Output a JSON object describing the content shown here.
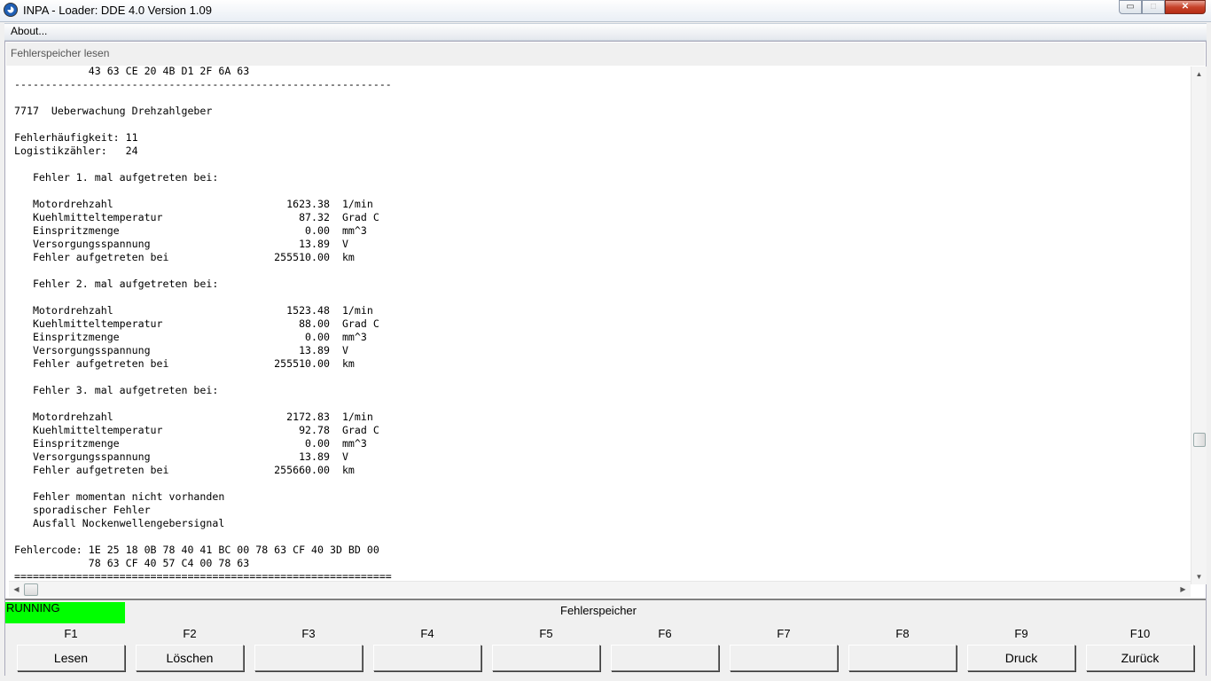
{
  "window": {
    "title": "INPA - Loader:  DDE 4.0 Version 1.09",
    "min_glyph": "▭",
    "max_glyph": "□",
    "close_glyph": "✕",
    "icon": "bmw-logo-icon"
  },
  "menu": {
    "about": "About..."
  },
  "section": {
    "title": "Fehlerspeicher lesen"
  },
  "report_lines": [
    "            43 63 CE 20 4B D1 2F 6A 63",
    "-------------------------------------------------------------",
    "",
    "7717  Ueberwachung Drehzahlgeber",
    "",
    "Fehlerhäufigkeit: 11",
    "Logistikzähler:   24",
    "",
    "   Fehler 1. mal aufgetreten bei:",
    "",
    "   Motordrehzahl                            1623.38  1/min",
    "   Kuehlmitteltemperatur                      87.32  Grad C",
    "   Einspritzmenge                              0.00  mm^3",
    "   Versorgungsspannung                        13.89  V",
    "   Fehler aufgetreten bei                 255510.00  km",
    "",
    "   Fehler 2. mal aufgetreten bei:",
    "",
    "   Motordrehzahl                            1523.48  1/min",
    "   Kuehlmitteltemperatur                      88.00  Grad C",
    "   Einspritzmenge                              0.00  mm^3",
    "   Versorgungsspannung                        13.89  V",
    "   Fehler aufgetreten bei                 255510.00  km",
    "",
    "   Fehler 3. mal aufgetreten bei:",
    "",
    "   Motordrehzahl                            2172.83  1/min",
    "   Kuehlmitteltemperatur                      92.78  Grad C",
    "   Einspritzmenge                              0.00  mm^3",
    "   Versorgungsspannung                        13.89  V",
    "   Fehler aufgetreten bei                 255660.00  km",
    "",
    "   Fehler momentan nicht vorhanden",
    "   sporadischer Fehler",
    "   Ausfall Nockenwellengebersignal",
    "",
    "Fehlercode: 1E 25 18 0B 78 40 41 BC 00 78 63 CF 40 3D BD 00",
    "            78 63 CF 40 57 C4 00 78 63",
    "============================================================="
  ],
  "scroll": {
    "up": "▲",
    "down": "▼",
    "left": "◀",
    "right": "▶"
  },
  "status": {
    "state": "RUNNING",
    "title": "Fehlerspeicher",
    "state_color": "#00ff00"
  },
  "function_keys": [
    {
      "key": "F1",
      "label": "Lesen"
    },
    {
      "key": "F2",
      "label": "Löschen"
    },
    {
      "key": "F3",
      "label": ""
    },
    {
      "key": "F4",
      "label": ""
    },
    {
      "key": "F5",
      "label": ""
    },
    {
      "key": "F6",
      "label": ""
    },
    {
      "key": "F7",
      "label": ""
    },
    {
      "key": "F8",
      "label": ""
    },
    {
      "key": "F9",
      "label": "Druck"
    },
    {
      "key": "F10",
      "label": "Zurück"
    }
  ]
}
